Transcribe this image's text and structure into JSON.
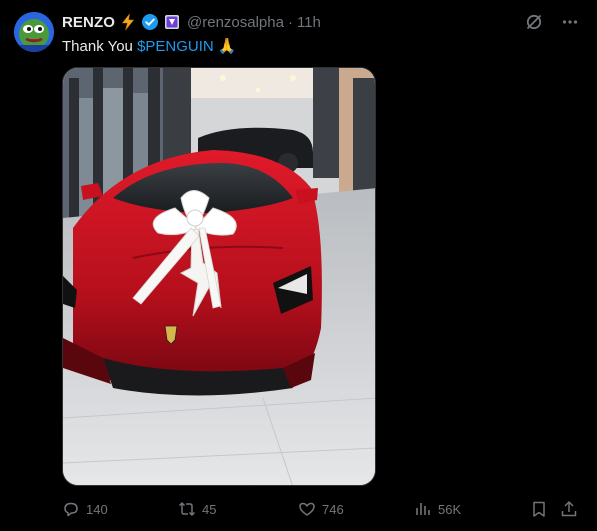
{
  "author": {
    "name": "RENZO",
    "handle": "@renzosalpha",
    "separator": "·",
    "time": "11h"
  },
  "tweet": {
    "text_plain": "Thank You ",
    "cashtag": "$PENGUIN",
    "emoji": "🙏"
  },
  "media": {
    "description_icon": "photo-of-red-supercar-with-white-bow"
  },
  "actions": {
    "replies": "140",
    "reposts": "45",
    "likes": "746",
    "views": "56K"
  },
  "colors": {
    "background": "#000000",
    "text": "#e7e9ea",
    "muted": "#71767b",
    "accent": "#1d9bf0",
    "verified": "#1d9bf0"
  }
}
